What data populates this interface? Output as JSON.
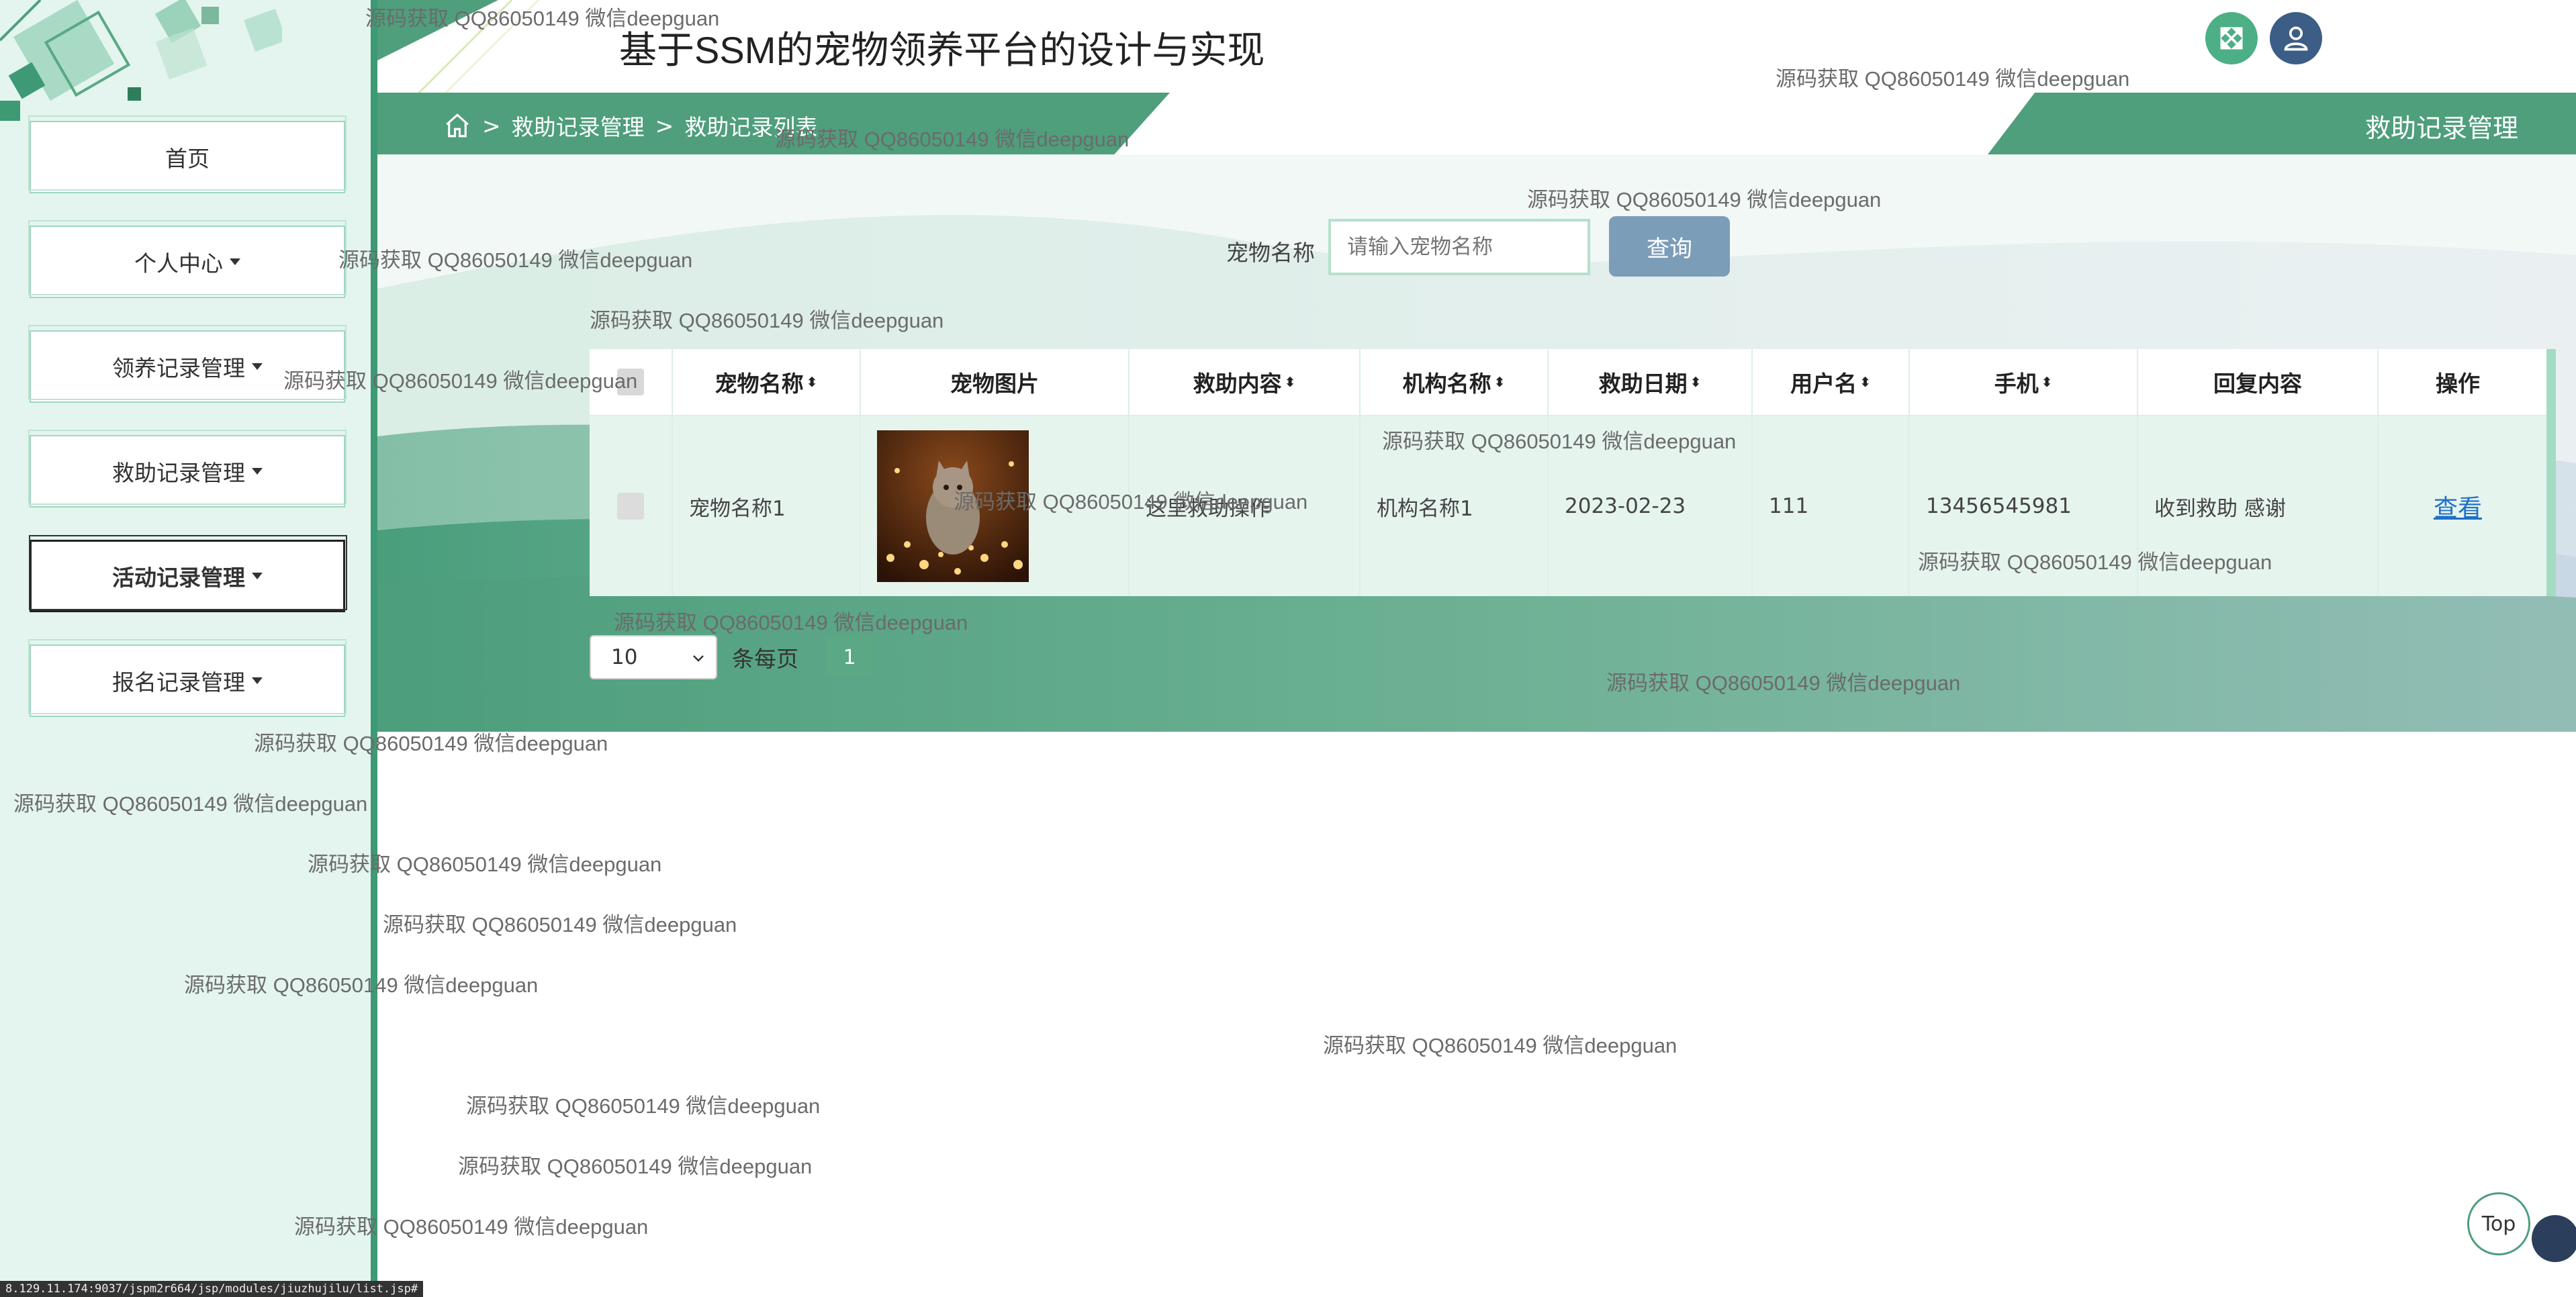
{
  "app": {
    "title": "基于SSM的宠物领养平台的设计与实现",
    "breadcrumb": [
      "救助记录管理",
      "救助记录列表"
    ],
    "section_title": "救助记录管理"
  },
  "sidebar": {
    "items": [
      {
        "label": "首页",
        "has_caret": false,
        "active": false
      },
      {
        "label": "个人中心",
        "has_caret": true,
        "active": false
      },
      {
        "label": "领养记录管理",
        "has_caret": true,
        "active": false
      },
      {
        "label": "救助记录管理",
        "has_caret": true,
        "active": false
      },
      {
        "label": "活动记录管理",
        "has_caret": true,
        "active": true
      },
      {
        "label": "报名记录管理",
        "has_caret": true,
        "active": false
      }
    ]
  },
  "search": {
    "label": "宠物名称",
    "placeholder": "请输入宠物名称",
    "button": "查询"
  },
  "table": {
    "headers": [
      "宠物名称",
      "宠物图片",
      "救助内容",
      "机构名称",
      "救助日期",
      "用户名",
      "手机",
      "回复内容",
      "操作"
    ],
    "sortable": [
      "宠物名称",
      "救助内容",
      "机构名称",
      "救助日期",
      "用户名",
      "手机"
    ],
    "rows": [
      {
        "pet_name": "宠物名称1",
        "image": "cat-photo",
        "rescue_content": "这里救助操作",
        "org_name": "机构名称1",
        "rescue_date": "2023-02-23",
        "username": "111",
        "phone": "13456545981",
        "reply": "收到救助 感谢",
        "action": "查看"
      }
    ]
  },
  "pagination": {
    "page_size": "10",
    "per_page_label": "条每页",
    "current_page": "1"
  },
  "top_button": "Top",
  "status_url": "8.129.11.174:9037/jspm2r664/jsp/modules/jiuzhujilu/list.jsp#",
  "watermark": "源码获取 QQ86050149 微信deepguan",
  "colors": {
    "primary_green": "#4f9e7c",
    "sidebar_bg": "#e3f5ee",
    "search_button": "#7c9db8",
    "link": "#1e6fc9"
  },
  "icons": [
    "home-icon",
    "fullscreen-icon",
    "user-icon"
  ]
}
